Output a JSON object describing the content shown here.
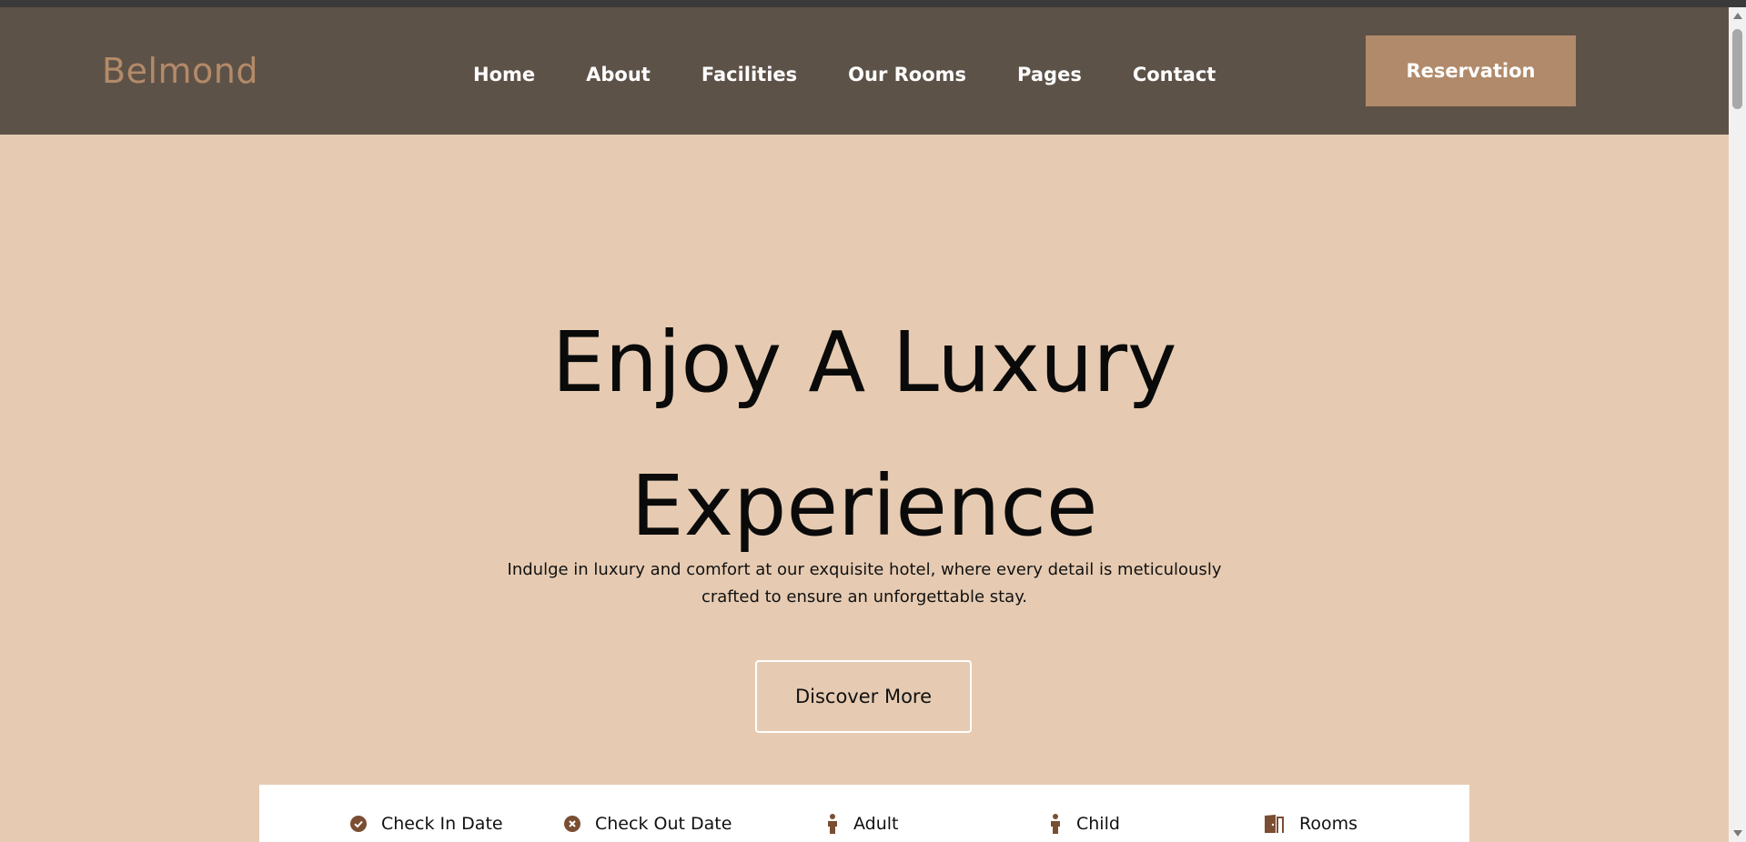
{
  "brand": "Belmond",
  "nav": {
    "items": [
      "Home",
      "About",
      "Facilities",
      "Our Rooms",
      "Pages",
      "Contact"
    ],
    "reservation_label": "Reservation"
  },
  "hero": {
    "title_line1": "Enjoy A Luxury",
    "title_line2": "Experience",
    "subtitle": "Indulge in luxury and comfort at our exquisite hotel, where every detail is meticulously crafted to ensure an unforgettable stay.",
    "cta_label": "Discover More"
  },
  "booking": {
    "fields": [
      {
        "label": "Check In Date",
        "icon": "check-circle-icon"
      },
      {
        "label": "Check Out Date",
        "icon": "x-circle-icon"
      },
      {
        "label": "Adult",
        "icon": "person-icon"
      },
      {
        "label": "Child",
        "icon": "person-icon"
      },
      {
        "label": "Rooms",
        "icon": "door-icon"
      }
    ]
  },
  "colors": {
    "nav_bg": "#5d5248",
    "brand": "#b48a68",
    "accent_button": "#b08a6a",
    "hero_bg": "#e6cbb2",
    "icon_brown": "#7a4e33"
  }
}
